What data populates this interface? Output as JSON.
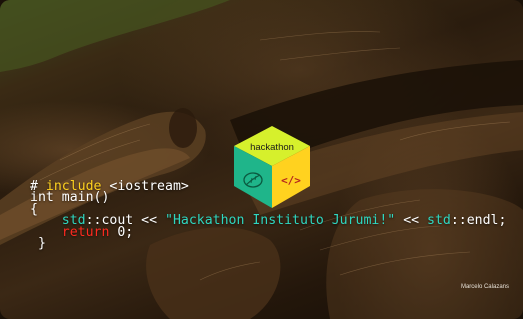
{
  "banner": {
    "code_lines": [
      {
        "hash": "#",
        "include": "include",
        "header": " <iostream>"
      },
      {
        "text": "int main()"
      },
      {
        "text": "{"
      },
      {
        "indent": "    ",
        "std1": "std",
        "cout": "::cout << ",
        "string": "\"Hackathon Instituto Jurumi!\"",
        "op": " << ",
        "std2": "std",
        "endl": "::endl;"
      },
      {
        "indent": "    ",
        "return_kw": "return",
        "rest": " 0;"
      },
      {
        "text": " }"
      }
    ],
    "logo": {
      "label": "hackathon",
      "code_glyph": "</>"
    },
    "credit": "Marcelo Calazans"
  },
  "colors": {
    "include": "#ffd21f",
    "std": "#2fd6c0",
    "return": "#ff2a1f",
    "cube_top": "#d6f02c",
    "cube_left": "#1fb58a",
    "cube_right": "#ffd21f"
  }
}
